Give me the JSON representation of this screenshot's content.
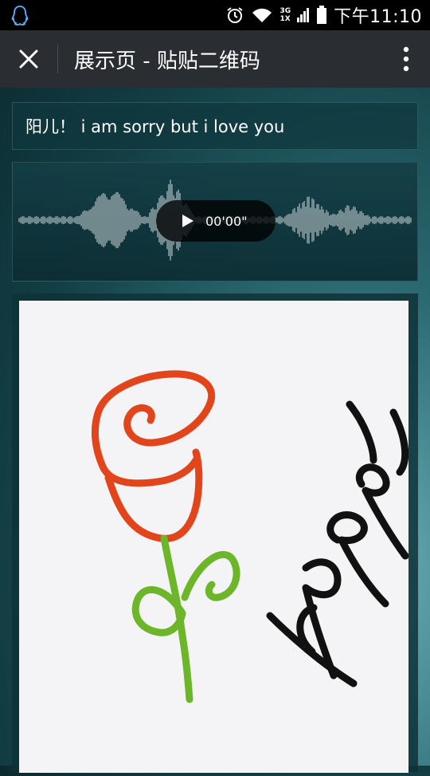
{
  "status_bar": {
    "network_type_top": "3G",
    "network_type_bottom": "1X",
    "time": "下午11:10"
  },
  "title_bar": {
    "title": "展示页 - 贴贴二维码"
  },
  "message": {
    "text": "阳儿！ i am sorry but i love you"
  },
  "audio": {
    "duration": "00'00\""
  },
  "drawing": {
    "text": "happy",
    "colors": {
      "rose": "#e2451c",
      "stem": "#6db62a",
      "ink": "#111111"
    }
  },
  "icons": [
    "qq-penguin-icon",
    "alarm-icon",
    "wifi-icon",
    "signal-icon",
    "battery-icon",
    "close-icon",
    "more-vert-icon",
    "play-icon"
  ]
}
